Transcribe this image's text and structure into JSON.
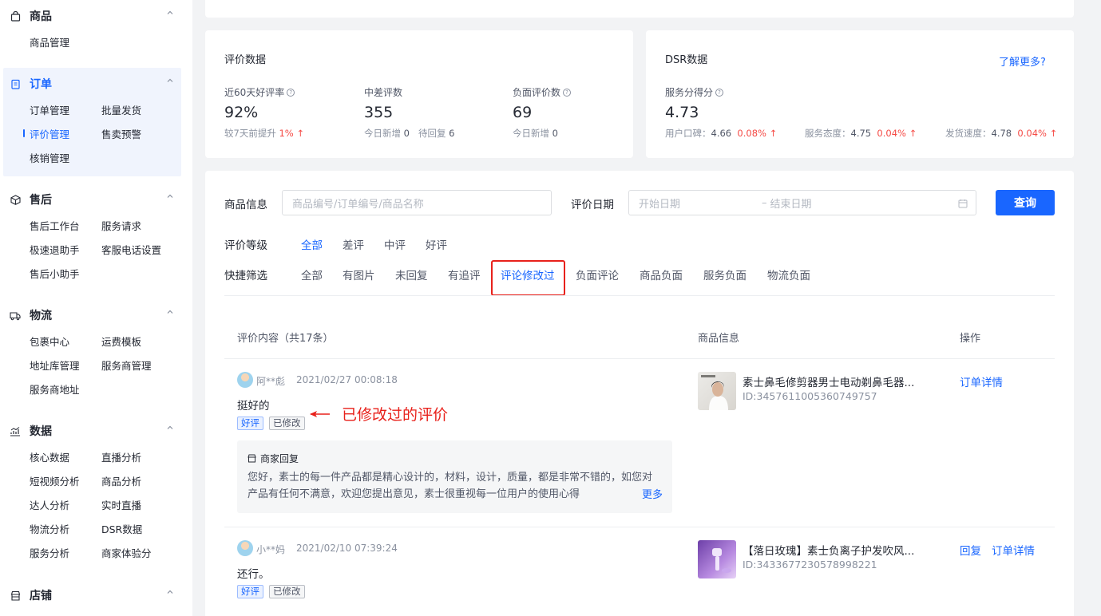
{
  "sidebar": {
    "groups": [
      {
        "title": "商品",
        "icon": "bag-icon",
        "items": [
          "商品管理"
        ]
      },
      {
        "title": "订单",
        "icon": "order-icon",
        "items": [
          "订单管理",
          "批量发货",
          "评价管理",
          "售卖预警",
          "核销管理"
        ],
        "active_item": "评价管理"
      },
      {
        "title": "售后",
        "icon": "box-icon",
        "items": [
          "售后工作台",
          "服务请求",
          "极速退助手",
          "客服电话设置",
          "售后小助手"
        ]
      },
      {
        "title": "物流",
        "icon": "truck-icon",
        "items": [
          "包裹中心",
          "运费模板",
          "地址库管理",
          "服务商管理",
          "服务商地址"
        ]
      },
      {
        "title": "数据",
        "icon": "chart-icon",
        "items": [
          "核心数据",
          "直播分析",
          "短视频分析",
          "商品分析",
          "达人分析",
          "实时直播",
          "物流分析",
          "DSR数据",
          "服务分析",
          "商家体验分"
        ]
      },
      {
        "title": "店铺",
        "icon": "shop-icon",
        "items": []
      }
    ]
  },
  "review_stats": {
    "title": "评价数据",
    "good_rate": {
      "label": "近60天好评率",
      "value": "92%",
      "sub_prefix": "较7天前提升",
      "sub_delta": "1%"
    },
    "mid_bad": {
      "label": "中差评数",
      "value": "355",
      "today_label": "今日新增",
      "today": "0",
      "pending_label": "待回复",
      "pending": "6"
    },
    "negative": {
      "label": "负面评价数",
      "value": "69",
      "today_label": "今日新增",
      "today": "0"
    }
  },
  "dsr": {
    "title": "DSR数据",
    "learn_more": "了解更多?",
    "score_label": "服务分得分",
    "score": "4.73",
    "metrics": [
      {
        "label": "用户口碑：",
        "value": "4.66",
        "delta": "0.08%"
      },
      {
        "label": "服务态度：",
        "value": "4.75",
        "delta": "0.04%"
      },
      {
        "label": "发货速度：",
        "value": "4.78",
        "delta": "0.04%"
      }
    ]
  },
  "filters": {
    "product_label": "商品信息",
    "product_placeholder": "商品编号/订单编号/商品名称",
    "date_label": "评价日期",
    "date_start": "开始日期",
    "date_sep": "–",
    "date_end": "结束日期",
    "query": "查询",
    "level_label": "评价等级",
    "levels": [
      "全部",
      "差评",
      "中评",
      "好评"
    ],
    "level_active": "全部",
    "quick_label": "快捷筛选",
    "quick": [
      "全部",
      "有图片",
      "未回复",
      "有追评",
      "评论修改过",
      "负面评论",
      "商品负面",
      "服务负面",
      "物流负面"
    ],
    "quick_active": "评论修改过"
  },
  "table": {
    "col_content": "评价内容（共17条）",
    "col_product": "商品信息",
    "col_action": "操作",
    "rows": [
      {
        "user": "阿**彪",
        "time": "2021/02/27 00:08:18",
        "text": "挺好的",
        "tags": [
          "好评",
          "已修改"
        ],
        "reply_title": "商家回复",
        "reply": "您好，素士的每一件产品都是精心设计的，材料，设计，质量，都是非常不错的，如您对产品有任何不满意，欢迎您提出意见，素士很重视每一位用户的使用心得",
        "reply_more": "更多",
        "product": "素士鼻毛修剪器男士电动剃鼻毛器...",
        "product_id": "ID:3457611005360749757",
        "actions": [
          "订单详情"
        ]
      },
      {
        "user": "小**妈",
        "time": "2021/02/10 07:39:24",
        "text": "还行。",
        "tags": [
          "好评",
          "已修改"
        ],
        "product": "【落日玫瑰】素士负离子护发吹风...",
        "product_id": "ID:3433677230578998221",
        "actions": [
          "回复",
          "订单详情"
        ]
      }
    ]
  },
  "annotation": "已修改过的评价"
}
